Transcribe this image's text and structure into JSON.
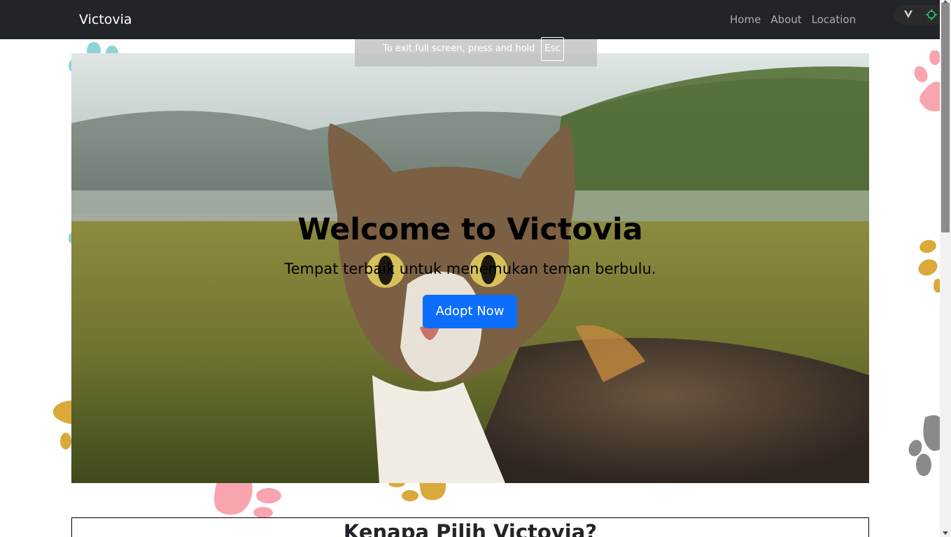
{
  "navbar": {
    "brand": "Victovia",
    "links": [
      "Home",
      "About",
      "Location"
    ]
  },
  "fullscreen_notice": {
    "text": "To exit full screen, press and hold",
    "key": "Esc"
  },
  "hero": {
    "title": "Welcome to Victovia",
    "subtitle": "Tempat terbaik untuk menemukan teman berbulu.",
    "button_label": "Adopt Now",
    "image": "cat-in-grass-photo"
  },
  "why_section": {
    "title": "Kenapa Pilih Victovia?"
  },
  "colors": {
    "navbar_bg": "#212529",
    "primary_button": "#0d6efd",
    "paw_pink": "#f8a5b0",
    "paw_gold": "#d9a93a",
    "paw_teal": "#8fd3d8",
    "paw_gray": "#8a8a8a"
  },
  "icons": [
    "vivaldi-v-icon",
    "target-icon",
    "paw-print-icon"
  ]
}
